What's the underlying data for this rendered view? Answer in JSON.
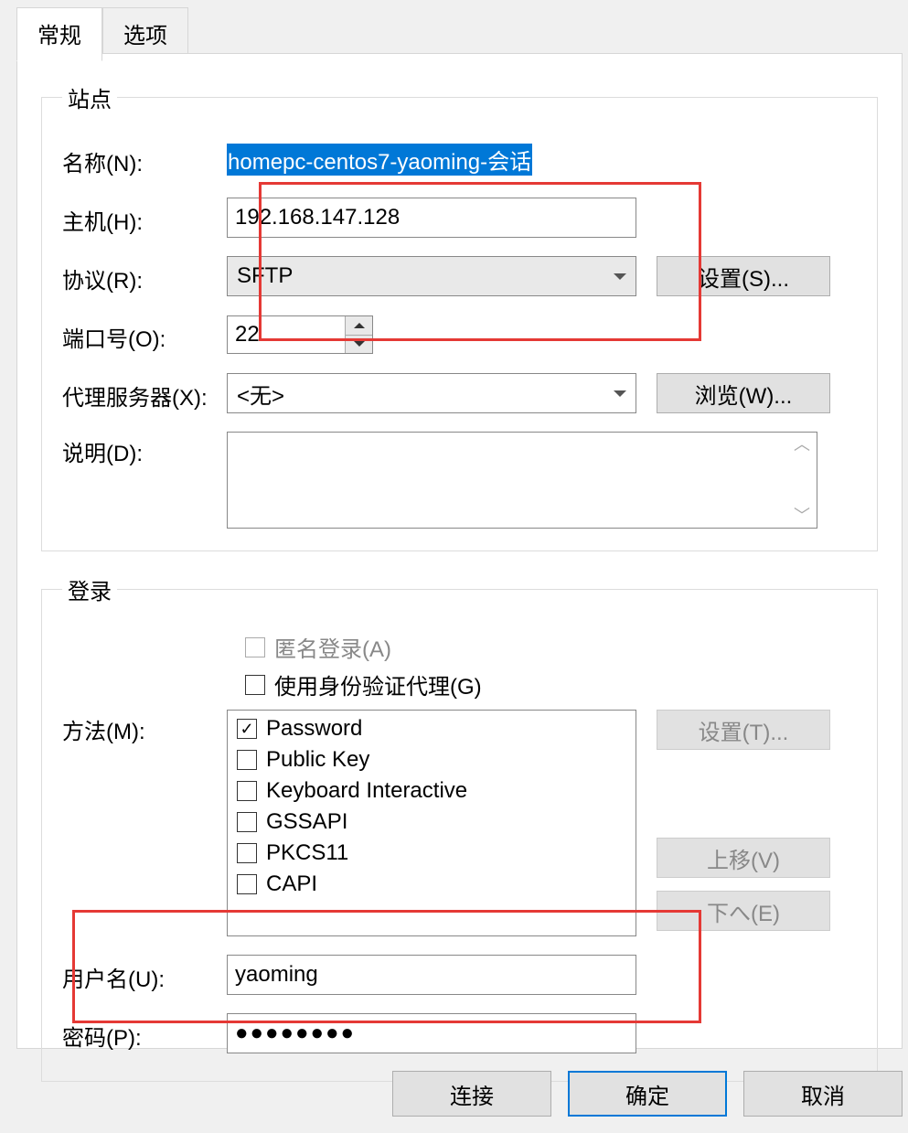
{
  "tabs": {
    "general": "常规",
    "options": "选项"
  },
  "site": {
    "legend": "站点",
    "name_label": "名称(N):",
    "name_value": "homepc-centos7-yaoming-会话",
    "host_label": "主机(H):",
    "host_value": "192.168.147.128",
    "protocol_label": "协议(R):",
    "protocol_value": "SFTP",
    "settings_btn": "设置(S)...",
    "port_label": "端口号(O):",
    "port_value": "22",
    "proxy_label": "代理服务器(X):",
    "proxy_value": "<无>",
    "browse_btn": "浏览(W)...",
    "desc_label": "说明(D):"
  },
  "login": {
    "legend": "登录",
    "anon_label": "匿名登录(A)",
    "agent_label": "使用身份验证代理(G)",
    "method_label": "方法(M):",
    "methods": {
      "password": "Password",
      "publickey": "Public Key",
      "keyboard": "Keyboard Interactive",
      "gssapi": "GSSAPI",
      "pkcs11": "PKCS11",
      "capi": "CAPI"
    },
    "settings_btn": "设置(T)...",
    "moveup_btn": "上移(V)",
    "movedown_btn": "下へ(E)",
    "user_label": "用户名(U):",
    "user_value": "yaoming",
    "pass_label": "密码(P):",
    "pass_value": "●●●●●●●●"
  },
  "footer": {
    "connect": "连接",
    "ok": "确定",
    "cancel": "取消"
  }
}
